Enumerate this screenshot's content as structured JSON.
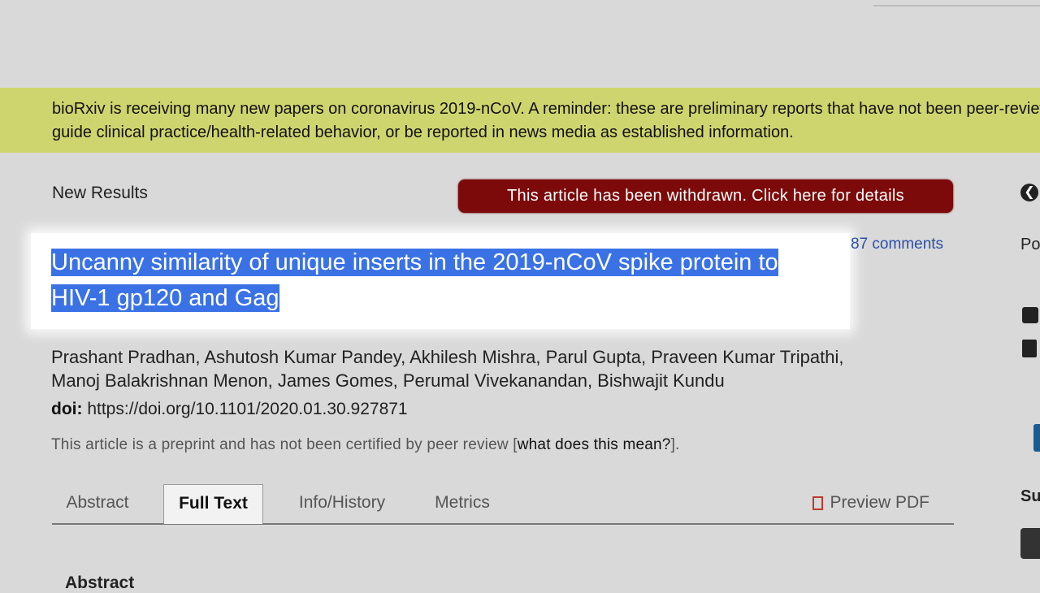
{
  "banner": {
    "line1": "bioRxiv is receiving many new papers on coronavirus 2019-nCoV.  A reminder: these are preliminary reports that have not been peer-reviewed. They should not be regarded as conclusive,",
    "line2": "guide clinical practice/health-related behavior, or be reported in news media as established information."
  },
  "article": {
    "section": "New Results",
    "withdrawn_notice": "This article has been withdrawn. Click here for details",
    "title_line1": "Uncanny similarity of unique inserts in the 2019-nCoV spike protein to",
    "title_line2": "HIV-1 gp120 and Gag",
    "comments": "87 comments",
    "authors_line1": "Prashant Pradhan, Ashutosh Kumar Pandey, Akhilesh Mishra, Parul Gupta, Praveen Kumar Tripathi,",
    "authors_line2": "Manoj Balakrishnan Menon, James Gomes, Perumal Vivekanandan, Bishwajit Kundu",
    "doi_label": "doi:",
    "doi_value": "https://doi.org/10.1101/2020.01.30.927871",
    "preprint_note": "This article is a preprint and has not been certified by peer review [",
    "preprint_link": "what does this mean?",
    "preprint_close": "]."
  },
  "tabs": {
    "abstract": "Abstract",
    "full_text": "Full Text",
    "info_history": "Info/History",
    "metrics": "Metrics",
    "preview_pdf": "Preview PDF"
  },
  "sidebar_right": {
    "po_label": "Po",
    "su_label": "Su"
  },
  "content": {
    "abstract_heading": "Abstract"
  },
  "colors": {
    "banner_bg": "#cfd56e",
    "withdrawn_bg": "#7d0a0a",
    "selection_bg": "#3a72e6",
    "link": "#2a4fa8"
  }
}
